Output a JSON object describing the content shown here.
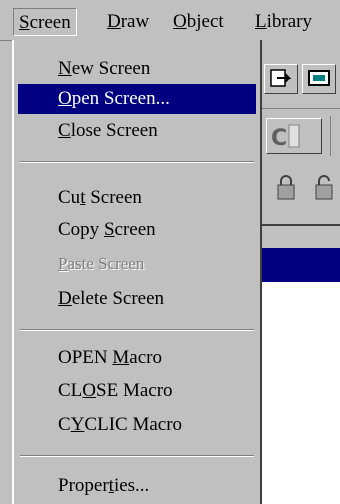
{
  "menubar": {
    "items": [
      {
        "hotkey": "S",
        "rest": "creen"
      },
      {
        "hotkey": "D",
        "rest": "raw"
      },
      {
        "hotkey": "O",
        "rest": "bject"
      },
      {
        "hotkey": "L",
        "rest": "ibrary"
      }
    ]
  },
  "menu": {
    "new_screen": {
      "pre": "",
      "hotkey": "N",
      "post": "ew Screen"
    },
    "open_screen": {
      "pre": "",
      "hotkey": "O",
      "post": "pen Screen..."
    },
    "close_screen": {
      "pre": "",
      "hotkey": "C",
      "post": "lose Screen"
    },
    "cut_screen": {
      "pre": "Cu",
      "hotkey": "t",
      "post": " Screen"
    },
    "copy_screen": {
      "pre": "Copy ",
      "hotkey": "S",
      "post": "creen"
    },
    "paste_screen": {
      "pre": "",
      "hotkey": "P",
      "post": "aste Screen"
    },
    "delete_screen": {
      "pre": "",
      "hotkey": "D",
      "post": "elete Screen"
    },
    "open_macro": {
      "pre": "OPEN ",
      "hotkey": "M",
      "post": "acro"
    },
    "close_macro": {
      "pre": "CL",
      "hotkey": "O",
      "post": "SE Macro"
    },
    "cyclic_macro": {
      "pre": "C",
      "hotkey": "Y",
      "post": "CLIC Macro"
    },
    "properties": {
      "pre": "Proper",
      "hotkey": "t",
      "post": "ies..."
    }
  }
}
